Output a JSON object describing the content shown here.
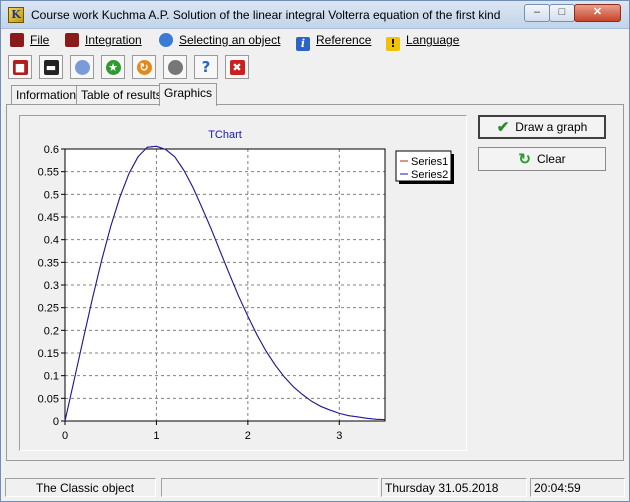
{
  "window": {
    "title": "Course work Kuchma A.P. Solution of the linear integral Volterra equation of the first kind",
    "min_glyph": "–",
    "max_glyph": "□",
    "close_glyph": "✕"
  },
  "menu": {
    "items": [
      {
        "label": "File",
        "icon": "file-menu-icon",
        "color": "#8b1a1a"
      },
      {
        "label": "Integration",
        "icon": "integration-menu-icon",
        "color": "#8b1a1a"
      },
      {
        "label": "Selecting an object",
        "icon": "users-menu-icon",
        "color": "#3a7bd5"
      },
      {
        "label": "Reference",
        "icon": "info-menu-icon",
        "color": "#2a64c4"
      },
      {
        "label": "Language",
        "icon": "warning-menu-icon",
        "color": "#f2c200"
      }
    ]
  },
  "toolbar": {
    "buttons": [
      {
        "name": "save-icon",
        "color": "#b01e1e",
        "glyph": "■"
      },
      {
        "name": "open-folder-icon",
        "color": "#222222",
        "glyph": "▬"
      },
      {
        "name": "object-icon",
        "color": "#7a9ad8",
        "glyph": "●"
      },
      {
        "name": "leaf-icon",
        "color": "#2f9a2f",
        "glyph": "★"
      },
      {
        "name": "orange-refresh-icon",
        "color": "#e38a1c",
        "glyph": "↻"
      },
      {
        "name": "gray-ball-icon",
        "color": "#777777",
        "glyph": "●"
      },
      {
        "name": "help-icon",
        "color": "#2a64c4",
        "glyph": "?"
      },
      {
        "name": "close-red-icon",
        "color": "#cc1f1f",
        "glyph": "✖"
      }
    ]
  },
  "tabs": [
    "Information",
    "Table of results",
    "Graphics"
  ],
  "active_tab": "Graphics",
  "buttons": {
    "draw": "Draw a graph",
    "clear": "Clear"
  },
  "status": {
    "object": "The Classic object",
    "empty": "",
    "date": "Thursday 31.05.2018",
    "time": "20:04:59"
  },
  "chart_data": {
    "type": "line",
    "title": "TChart",
    "xlabel": "",
    "ylabel": "",
    "xlim": [
      0,
      3.5
    ],
    "ylim": [
      0,
      0.6
    ],
    "grid": true,
    "legend": "top-right",
    "x_ticks": [
      "0",
      "1",
      "2",
      "3"
    ],
    "y_ticks": [
      "0",
      "0.05",
      "0.1",
      "0.15",
      "0.2",
      "0.25",
      "0.3",
      "0.35",
      "0.4",
      "0.45",
      "0.5",
      "0.55",
      "0.6"
    ],
    "series": [
      {
        "name": "Series1",
        "color": "#b02a1a",
        "x": [
          0,
          0.1,
          0.2,
          0.3,
          0.4,
          0.5,
          0.6,
          0.7,
          0.8,
          0.9,
          1.0,
          1.1,
          1.2,
          1.3,
          1.4,
          1.5,
          1.6,
          1.7,
          1.8,
          1.9,
          2.0,
          2.1,
          2.2,
          2.3,
          2.4,
          2.5,
          2.6,
          2.7,
          2.8,
          2.9,
          3.0,
          3.1,
          3.2,
          3.3,
          3.4,
          3.5
        ],
        "y": [
          0,
          0.09,
          0.181,
          0.27,
          0.354,
          0.429,
          0.494,
          0.546,
          0.583,
          0.604,
          0.606,
          0.599,
          0.583,
          0.553,
          0.515,
          0.47,
          0.423,
          0.373,
          0.323,
          0.275,
          0.231,
          0.19,
          0.154,
          0.123,
          0.097,
          0.075,
          0.058,
          0.043,
          0.032,
          0.024,
          0.017,
          0.012,
          0.009,
          0.006,
          0.004,
          0.003
        ]
      },
      {
        "name": "Series2",
        "color": "#1a1aa8",
        "x": [
          0,
          0.1,
          0.2,
          0.3,
          0.4,
          0.5,
          0.6,
          0.7,
          0.8,
          0.9,
          1.0,
          1.1,
          1.2,
          1.3,
          1.4,
          1.5,
          1.6,
          1.7,
          1.8,
          1.9,
          2.0,
          2.1,
          2.2,
          2.3,
          2.4,
          2.5,
          2.6,
          2.7,
          2.8,
          2.9,
          3.0,
          3.1,
          3.2,
          3.3,
          3.4,
          3.5
        ],
        "y": [
          0,
          0.09,
          0.181,
          0.27,
          0.354,
          0.429,
          0.494,
          0.546,
          0.583,
          0.604,
          0.606,
          0.599,
          0.583,
          0.553,
          0.515,
          0.47,
          0.423,
          0.373,
          0.323,
          0.275,
          0.231,
          0.19,
          0.154,
          0.123,
          0.097,
          0.075,
          0.058,
          0.043,
          0.032,
          0.024,
          0.017,
          0.012,
          0.009,
          0.006,
          0.004,
          0.003
        ]
      }
    ]
  }
}
